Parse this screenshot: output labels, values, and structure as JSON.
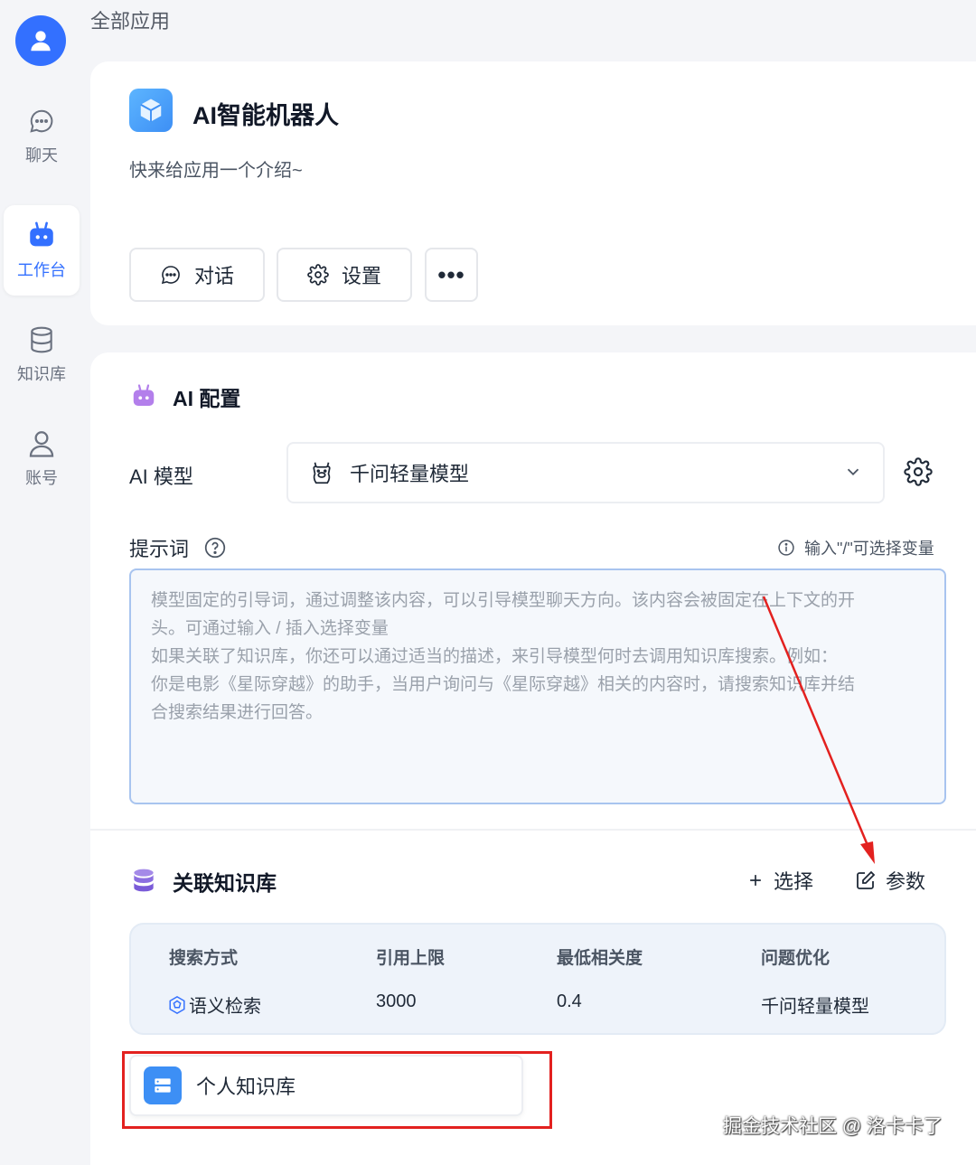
{
  "sidebar": {
    "items": [
      {
        "label": "聊天",
        "icon": "chat-icon"
      },
      {
        "label": "工作台",
        "icon": "robot-icon"
      },
      {
        "label": "知识库",
        "icon": "database-icon"
      },
      {
        "label": "账号",
        "icon": "user-icon"
      }
    ],
    "active_color": "#3370ff"
  },
  "page": {
    "title": "全部应用"
  },
  "app": {
    "name": "AI智能机器人",
    "description": "快来给应用一个介绍~",
    "buttons": {
      "chat": "对话",
      "settings": "设置",
      "more": "•••"
    }
  },
  "ai_config": {
    "title": "AI 配置",
    "model_label": "AI 模型",
    "model_value": "千问轻量模型",
    "prompt_label": "提示词",
    "var_hint": "输入\"/\"可选择变量",
    "prompt_placeholder_lines": [
      "模型固定的引导词，通过调整该内容，可以引导模型聊天方向。该内容会被固定在上下文的开",
      "头。可通过输入 / 插入选择变量",
      "如果关联了知识库，你还可以通过适当的描述，来引导模型何时去调用知识库搜索。例如：",
      "你是电影《星际穿越》的助手，当用户询问与《星际穿越》相关的内容时，请搜索知识库并结",
      "合搜索结果进行回答。"
    ]
  },
  "knowledge": {
    "title": "关联知识库",
    "select_label": "选择",
    "params_label": "参数",
    "table": {
      "headers": [
        "搜索方式",
        "引用上限",
        "最低相关度",
        "问题优化"
      ],
      "values": [
        "语义检索",
        "3000",
        "0.4",
        "千问轻量模型"
      ]
    },
    "item_name": "个人知识库"
  },
  "annotation": {
    "highlight_color": "#e3211f"
  },
  "watermark": "掘金技术社区 @ 洛卡卡了"
}
